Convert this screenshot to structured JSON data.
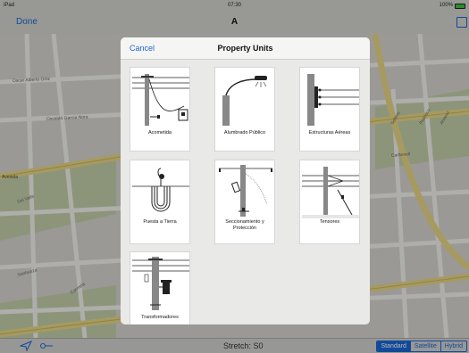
{
  "status_bar": {
    "device": "iPad",
    "time": "07:30",
    "battery": "100%"
  },
  "nav": {
    "done_label": "Done",
    "title": "A"
  },
  "map_labels": {
    "street_1": "Oscar Alberto Ortiz",
    "street_2": "Osvaldo Garcia Nora",
    "street_3": "Soltero",
    "street_4": "Pedrisco",
    "street_5": "Alvarez",
    "street_6": "Carbonell",
    "left_edge": "Avenida",
    "left_edge_2": "Del Valle",
    "bottom_left": "Sanhueza",
    "bottom_mid": "Carmela"
  },
  "modal": {
    "cancel_label": "Cancel",
    "title": "Property Units",
    "items": [
      {
        "label": "Acometida",
        "icon": "service-drop-icon"
      },
      {
        "label": "Alumbrado Público",
        "icon": "street-light-icon"
      },
      {
        "label": "Estructuras Aéreas",
        "icon": "aerial-structure-icon"
      },
      {
        "label": "Puesta a Tierra",
        "icon": "grounding-icon"
      },
      {
        "label": "Seccionamiento y Protección",
        "icon": "switch-protection-icon"
      },
      {
        "label": "Tensores",
        "icon": "guy-wire-icon"
      },
      {
        "label": "Transformadores",
        "icon": "transformer-icon"
      }
    ]
  },
  "toolbar": {
    "stretch_text": "Stretch: S0",
    "map_types": [
      "Standard",
      "Satellite",
      "Hybrid"
    ],
    "selected_map_type": "Standard"
  },
  "colors": {
    "accent": "#1a67d6",
    "road_yellow": "#e7d685",
    "map_bg": "#eceae4",
    "park_green": "#cfdcb6"
  }
}
